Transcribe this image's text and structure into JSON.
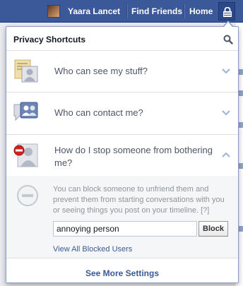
{
  "topbar": {
    "user_name": "Yaara Lancet",
    "find_friends": "Find Friends",
    "home": "Home"
  },
  "flyout": {
    "title": "Privacy Shortcuts",
    "shortcuts": [
      {
        "label": "Who can see my stuff?",
        "icon": "privacy-notes-icon",
        "state": "collapsed"
      },
      {
        "label": "Who can contact me?",
        "icon": "messages-people-icon",
        "state": "collapsed"
      },
      {
        "label": "How do I stop someone from bothering me?",
        "icon": "block-person-icon",
        "state": "expanded"
      }
    ],
    "block_panel": {
      "description": "You can block someone to unfriend them and prevent them from starting conversations with you or seeing things you post on your timeline.",
      "help_link": "[?]",
      "input_value": "annoying person",
      "block_button": "Block",
      "view_blocked": "View All Blocked Users"
    },
    "footer_link": "See More Settings"
  },
  "colors": {
    "brand": "#3b5998",
    "text_secondary": "#4e5665",
    "muted": "#90949c"
  }
}
